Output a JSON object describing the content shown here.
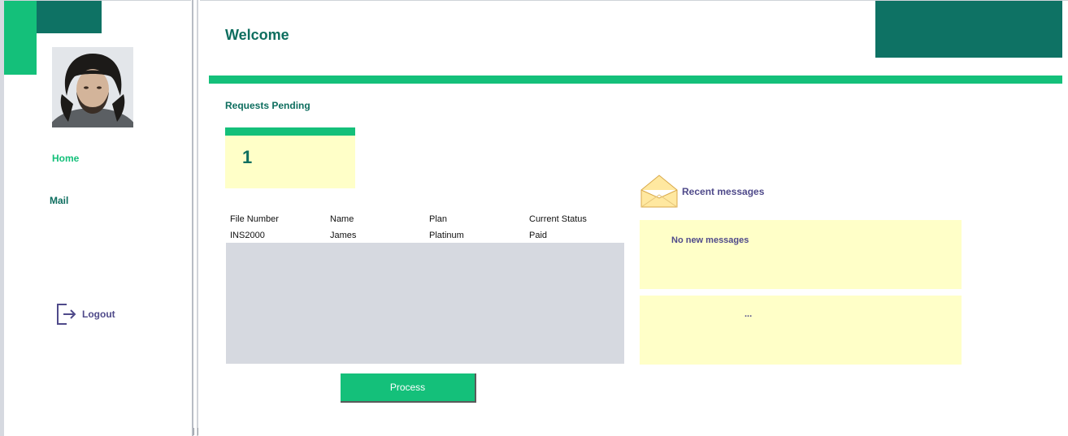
{
  "header": {
    "title": "Welcome"
  },
  "sidebar": {
    "avatar_alt": "user avatar",
    "items": [
      {
        "label": "Home",
        "active": true
      },
      {
        "label": "Mail",
        "active": false
      }
    ],
    "logout_label": "Logout"
  },
  "requests": {
    "title": "Requests Pending",
    "count": "1"
  },
  "table": {
    "columns": [
      "File Number",
      "Name",
      "Plan",
      "Current Status"
    ],
    "rows": [
      [
        "INS2000",
        "James",
        "Platinum",
        "Paid"
      ]
    ]
  },
  "actions": {
    "process_label": "Process"
  },
  "messages": {
    "title": "Recent messages",
    "items": [
      "No new messages",
      "..."
    ]
  },
  "colors": {
    "accent": "#14c07a",
    "dark_teal": "#0e7264",
    "card_bg": "#ffffc8",
    "grid_bg": "#d6d9e0",
    "text_purple": "#4f4a8a"
  },
  "icons": {
    "logout": "logout-icon",
    "envelope": "envelope-icon"
  }
}
